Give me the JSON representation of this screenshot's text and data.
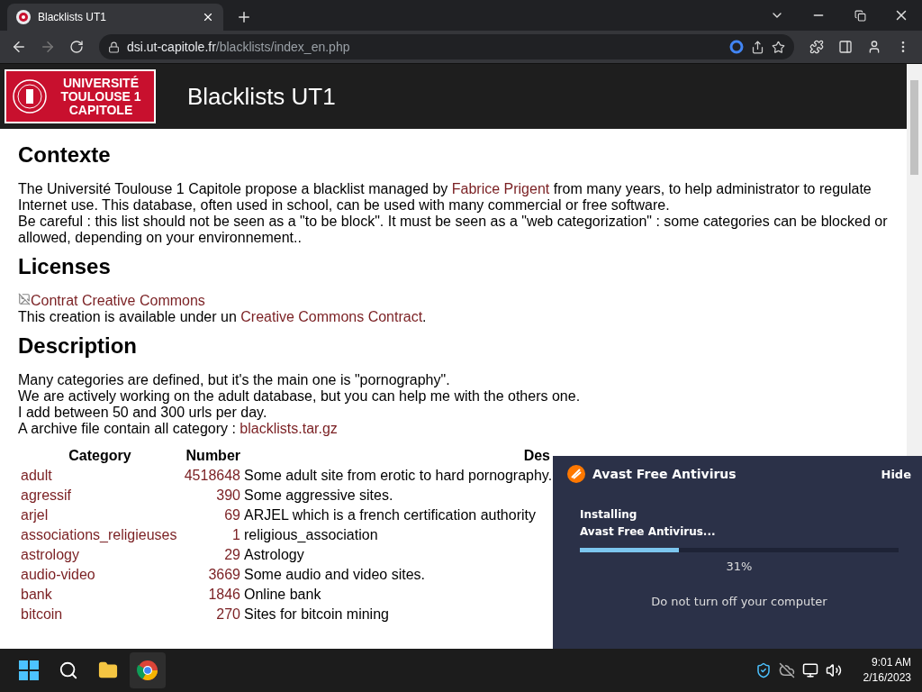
{
  "browser": {
    "tabs": [
      {
        "title": "Blacklists UT1",
        "selected": true
      }
    ],
    "address": {
      "host": "dsi.ut-capitole.fr",
      "path": "/blacklists/index_en.php"
    }
  },
  "site_header": {
    "logo_lines": [
      "UNIVERSITÉ",
      "TOULOUSE 1",
      "CAPITOLE"
    ],
    "title": "Blacklists UT1"
  },
  "content": [
    {
      "kind": "heading",
      "text": "Contexte"
    },
    {
      "kind": "paragraph",
      "lines": [
        [
          {
            "text": "The Université Toulouse 1 Capitole propose a blacklist managed by "
          },
          {
            "text": "Fabrice Prigent",
            "link": true
          },
          {
            "text": " from many years, to help administrator to regulate Internet use. This database, often used in school, can be used with many commercial or free software."
          }
        ],
        [
          {
            "text": "Be careful : this list should not be seen as a \"to be block\". It must be seen as a \"web categorization\" : some categories can be blocked or allowed, depending on your environnement.."
          }
        ]
      ]
    },
    {
      "kind": "heading",
      "text": "Licenses"
    },
    {
      "kind": "image",
      "alt": "Contrat Creative Commons"
    },
    {
      "kind": "paragraph",
      "lines": [
        [
          {
            "text": "This creation is available under un "
          },
          {
            "text": "Creative Commons Contract",
            "link": true
          },
          {
            "text": "."
          }
        ]
      ]
    },
    {
      "kind": "heading",
      "text": "Description"
    },
    {
      "kind": "paragraph",
      "lines": [
        [
          {
            "text": "Many categories are defined, but it's the main one is \"pornography\"."
          }
        ],
        [
          {
            "text": "We are actively working on the adult database, but you can help me with the others one."
          }
        ],
        [
          {
            "text": "I add between 50 and 300 urls per day."
          }
        ],
        [
          {
            "text": "A archive file contain all category : "
          },
          {
            "text": "blacklists.tar.gz",
            "link": true
          }
        ]
      ]
    }
  ],
  "table": {
    "columns": [
      "Category",
      "Number",
      "Des"
    ],
    "rows": [
      {
        "category": "adult",
        "number": "4518648",
        "description": "Some adult site from erotic to hard pornography."
      },
      {
        "category": "agressif",
        "number": "390",
        "description": "Some aggressive sites."
      },
      {
        "category": "arjel",
        "number": "69",
        "description": "ARJEL which is a french certification authority"
      },
      {
        "category": "associations_religieuses",
        "number": "1",
        "description": "religious_association"
      },
      {
        "category": "astrology",
        "number": "29",
        "description": "Astrology"
      },
      {
        "category": "audio-video",
        "number": "3669",
        "description": "Some audio and video sites."
      },
      {
        "category": "bank",
        "number": "1846",
        "description": "Online bank"
      },
      {
        "category": "bitcoin",
        "number": "270",
        "description": "Sites for bitcoin mining"
      }
    ]
  },
  "installer_popup": {
    "app_name": "Avast Free Antivirus",
    "hide": "Hide",
    "status_lines": [
      "Installing",
      "Avast Free Antivirus..."
    ],
    "level": 0.31,
    "percent": "31%",
    "note": "Do not turn off your computer"
  },
  "taskbar": {
    "time": "9:01 AM",
    "date": "2/16/2023"
  }
}
